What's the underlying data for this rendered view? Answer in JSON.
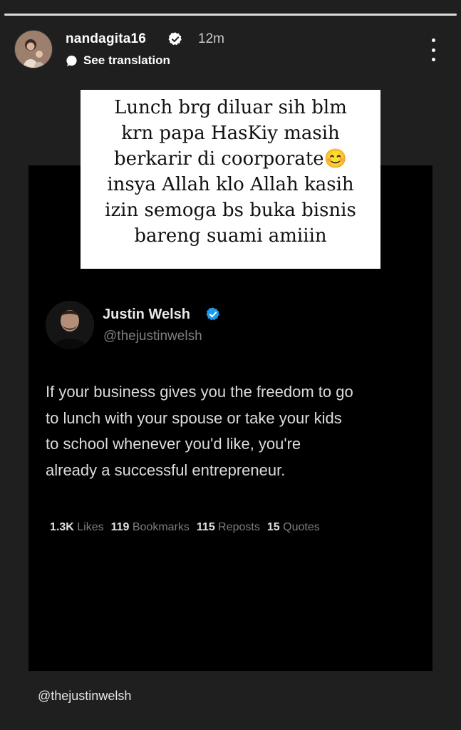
{
  "story": {
    "segments": 1,
    "username": "nandagita16",
    "time": "12m",
    "see_translation": "See translation",
    "caption_lines": [
      "Lunch brg diluar sih blm",
      "krn papa HasKiy masih",
      "berkarir di coorporate😊",
      "insya Allah klo Allah kasih",
      "izin semoga bs buka bisnis",
      "bareng suami amiiin"
    ],
    "mention": "@thejustinwelsh"
  },
  "post": {
    "name": "Justin Welsh",
    "handle": "@thejustinwelsh",
    "body_lines": [
      "If your business gives you the freedom to go",
      "to lunch with your spouse or take your kids",
      "to school whenever you'd like, you're",
      "already a successful entrepreneur."
    ],
    "stats": {
      "likes_count": "1.3K",
      "likes_label": "Likes",
      "bookmarks_count": "119",
      "bookmarks_label": "Bookmarks",
      "reposts_count": "115",
      "reposts_label": "Reposts",
      "quotes_count": "15",
      "quotes_label": "Quotes"
    }
  },
  "icons": {
    "verified": "verified-badge-icon",
    "translate": "translate-bubble-icon",
    "more": "more-vertical-icon"
  },
  "colors": {
    "background": "#1f1f1f",
    "post_background": "#000000",
    "twitter_blue": "#1d9bf0",
    "muted_text": "#7f7f7f"
  }
}
